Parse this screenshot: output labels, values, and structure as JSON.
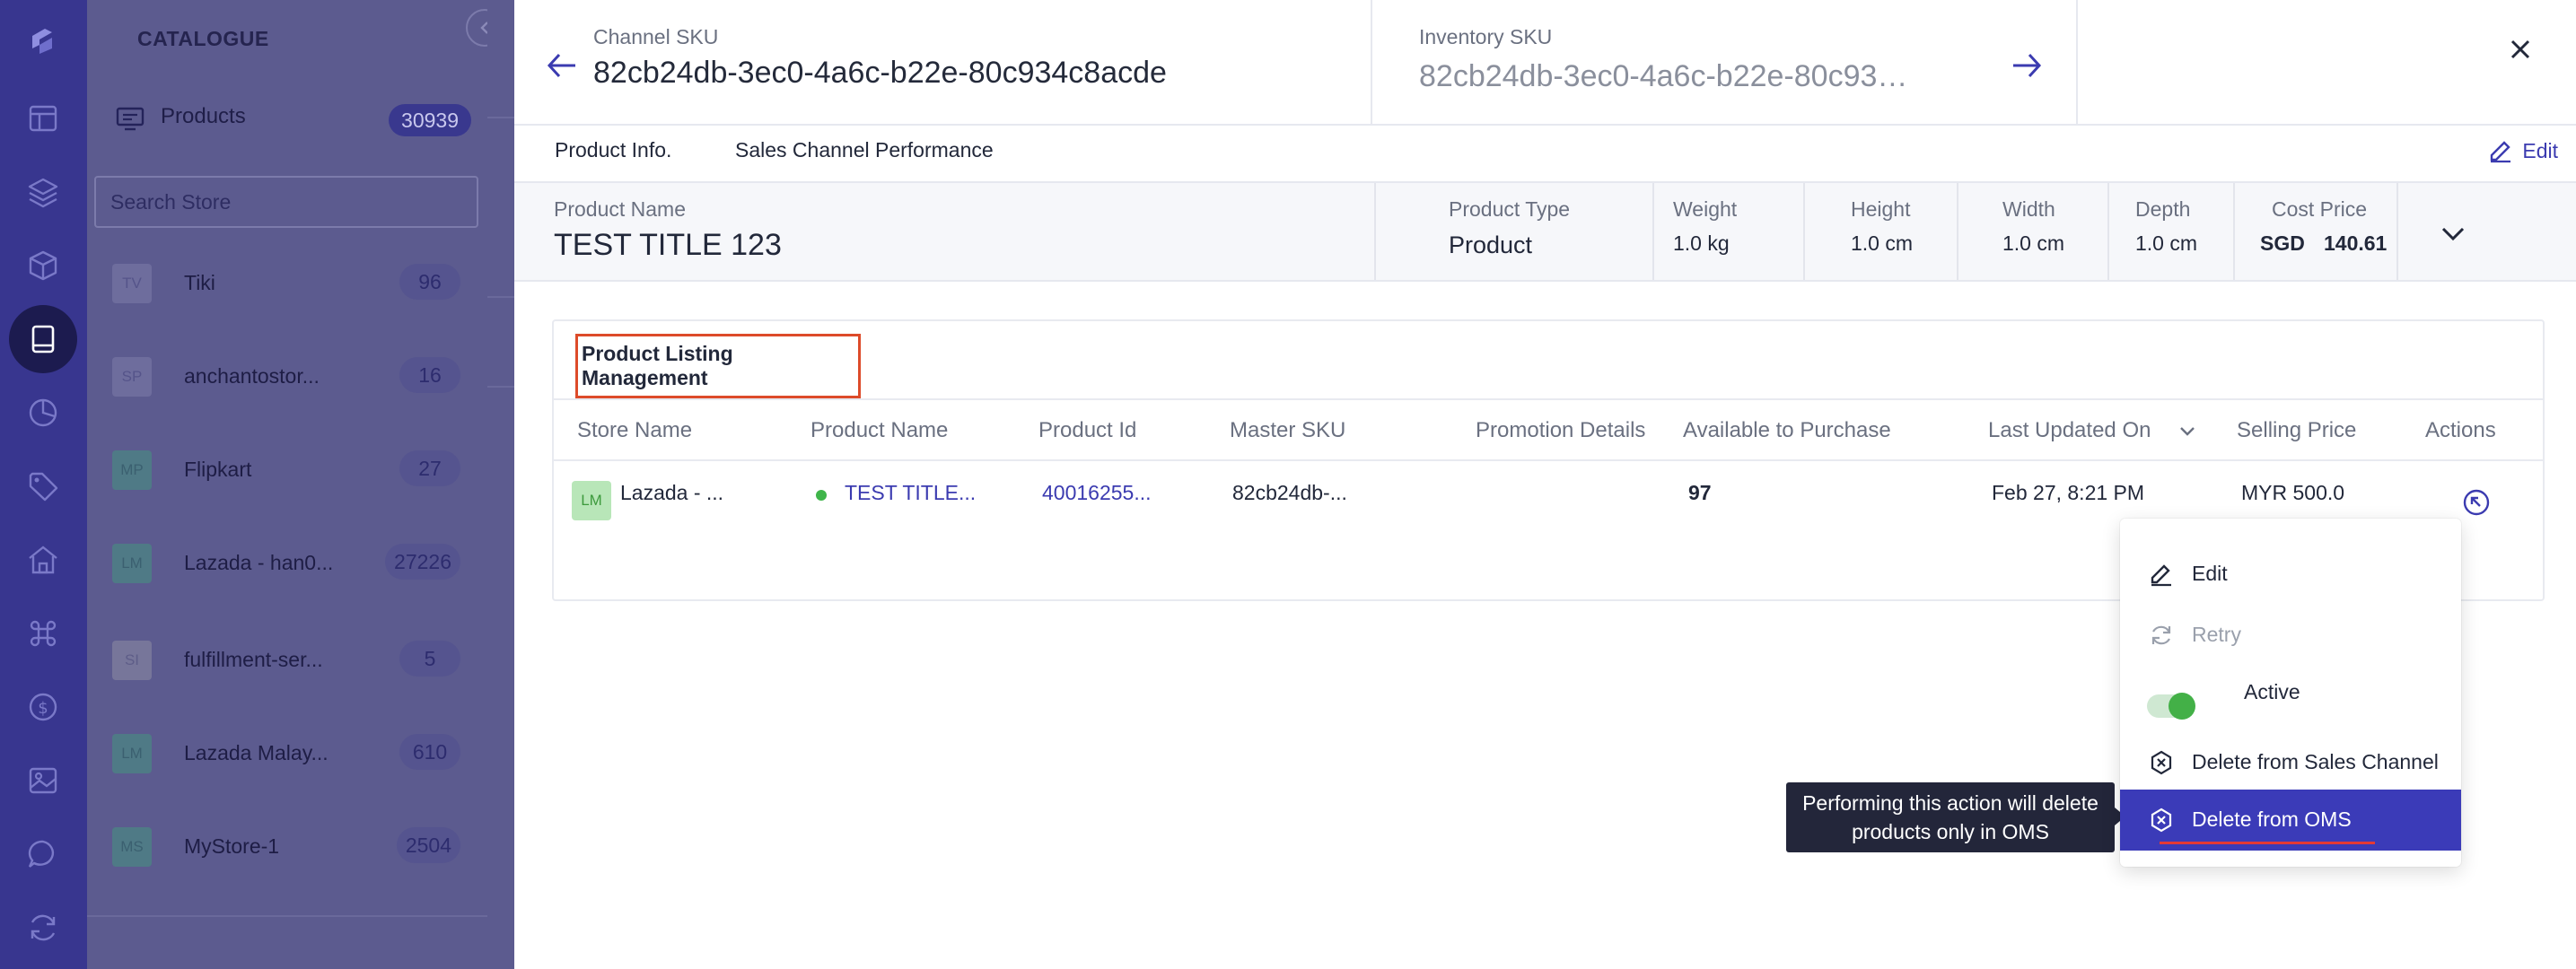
{
  "sidebar": {
    "title": "CATALOGUE",
    "products_label": "Products",
    "products_count": "30939",
    "search_placeholder": "Search Store",
    "stores": [
      {
        "initials": "TV",
        "name": "Tiki",
        "count": "96"
      },
      {
        "initials": "SP",
        "name": "anchantostor...",
        "count": "16"
      },
      {
        "initials": "MP",
        "name": "Flipkart",
        "count": "27"
      },
      {
        "initials": "LM",
        "name": "Lazada - han0...",
        "count": "27226"
      },
      {
        "initials": "SI",
        "name": "fulfillment-ser...",
        "count": "5"
      },
      {
        "initials": "LM",
        "name": "Lazada Malay...",
        "count": "610"
      },
      {
        "initials": "MS",
        "name": "MyStore-1",
        "count": "2504"
      }
    ]
  },
  "header": {
    "channel_sku_label": "Channel SKU",
    "channel_sku": "82cb24db-3ec0-4a6c-b22e-80c934c8acde",
    "inventory_sku_label": "Inventory SKU",
    "inventory_sku": "82cb24db-3ec0-4a6c-b22e-80c934c8acde"
  },
  "tabs": {
    "product_info": "Product Info.",
    "sales_channel": "Sales Channel Performance",
    "edit": "Edit"
  },
  "product": {
    "name_label": "Product Name",
    "name": "TEST TITLE 123",
    "type_label": "Product Type",
    "type": "Product",
    "weight_label": "Weight",
    "weight": "1.0 kg",
    "height_label": "Height",
    "height": "1.0 cm",
    "width_label": "Width",
    "width": "1.0 cm",
    "depth_label": "Depth",
    "depth": "1.0 cm",
    "cost_label": "Cost Price",
    "cost_currency": "SGD",
    "cost_value": "140.61"
  },
  "listing": {
    "title": "Product Listing Management",
    "columns": [
      "Store Name",
      "Product Name",
      "Product Id",
      "Master SKU",
      "Promotion Details",
      "Available to Purchase",
      "Last Updated On",
      "Selling Price",
      "Actions"
    ],
    "row": {
      "store_initials": "LM",
      "store_name": "Lazada - ...",
      "product_name": "TEST TITLE...",
      "product_id": "40016255...",
      "master_sku": "82cb24db-...",
      "promotion": "",
      "available": "97",
      "last_updated": "Feb 27, 8:21 PM",
      "selling_price": "MYR 500.0"
    }
  },
  "menu": {
    "edit": "Edit",
    "retry": "Retry",
    "active": "Active",
    "delete_channel": "Delete from Sales Channel",
    "delete_oms": "Delete from OMS",
    "tooltip": "Performing this action will delete products only in OMS"
  },
  "colors": {
    "rail": "#38368f",
    "accent": "#3b3bb8",
    "highlight_border": "#dd4b2a",
    "active_green": "#43b047"
  }
}
